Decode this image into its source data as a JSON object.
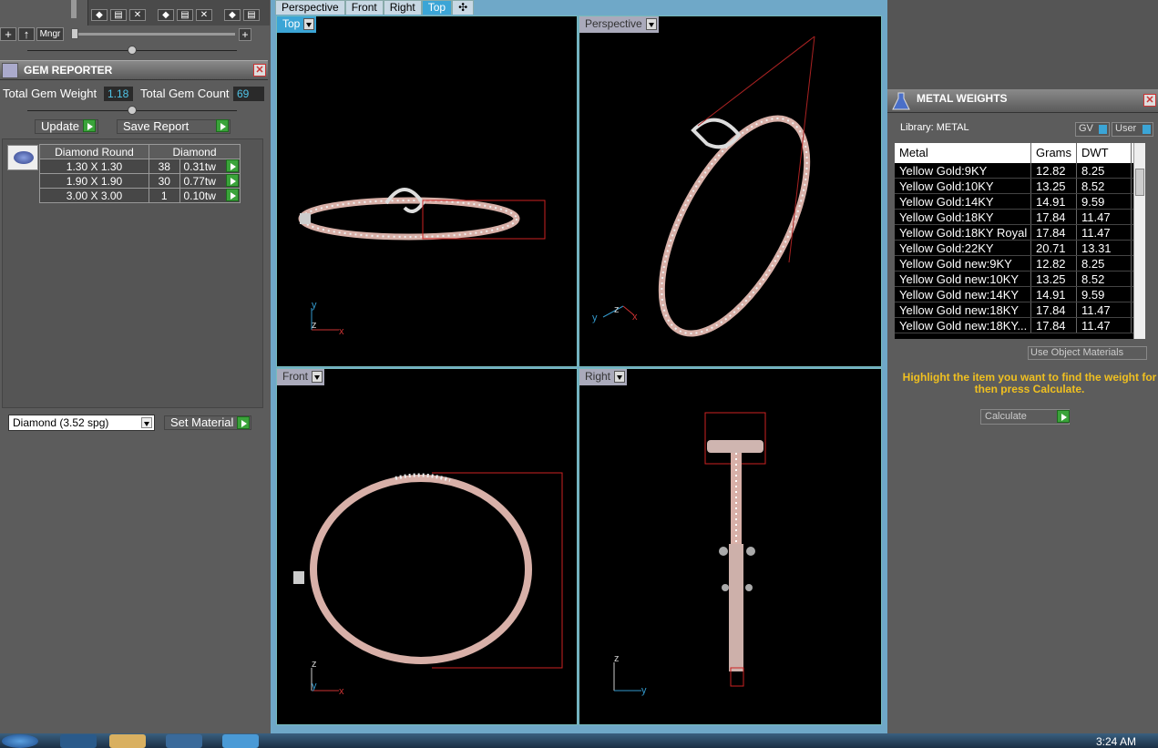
{
  "toolbar": {
    "add_label": "+",
    "up_label": "↑",
    "mngr_label": "Mngr",
    "plus_label": "+"
  },
  "gem_reporter": {
    "title": "GEM REPORTER",
    "total_weight_label": "Total Gem Weight",
    "total_weight_value": "1.18",
    "total_count_label": "Total Gem Count",
    "total_count_value": "69",
    "update_label": "Update",
    "save_report_label": "Save Report",
    "table": {
      "headers": [
        "Diamond Round",
        "Diamond"
      ],
      "rows": [
        {
          "size": "1.30 X 1.30",
          "count": "38",
          "tw": "0.31tw"
        },
        {
          "size": "1.90 X 1.90",
          "count": "30",
          "tw": "0.77tw"
        },
        {
          "size": "3.00 X 3.00",
          "count": "1",
          "tw": "0.10tw"
        }
      ]
    },
    "material_select": "Diamond    (3.52 spg)",
    "set_material_label": "Set Material"
  },
  "tabs": [
    {
      "label": "Perspective"
    },
    {
      "label": "Front"
    },
    {
      "label": "Right"
    },
    {
      "label": "Top"
    },
    {
      "label": "✣"
    }
  ],
  "viewports": {
    "top_left": "Top",
    "top_right": "Perspective",
    "bottom_left": "Front",
    "bottom_right": "Right"
  },
  "axes": {
    "y": "y",
    "z": "z",
    "x": "x"
  },
  "metal_weights": {
    "title": "METAL WEIGHTS",
    "library": "Library: METAL",
    "gv_label": "GV",
    "user_label": "User",
    "columns": [
      "Metal",
      "Grams",
      "DWT"
    ],
    "rows": [
      {
        "metal": "Yellow Gold:9KY",
        "grams": "12.82",
        "dwt": "8.25"
      },
      {
        "metal": "Yellow Gold:10KY",
        "grams": "13.25",
        "dwt": "8.52"
      },
      {
        "metal": "Yellow Gold:14KY",
        "grams": "14.91",
        "dwt": "9.59"
      },
      {
        "metal": "Yellow Gold:18KY",
        "grams": "17.84",
        "dwt": "11.47"
      },
      {
        "metal": "Yellow Gold:18KY Royal",
        "grams": "17.84",
        "dwt": "11.47"
      },
      {
        "metal": "Yellow Gold:22KY",
        "grams": "20.71",
        "dwt": "13.31"
      },
      {
        "metal": "Yellow Gold new:9KY",
        "grams": "12.82",
        "dwt": "8.25"
      },
      {
        "metal": "Yellow Gold new:10KY",
        "grams": "13.25",
        "dwt": "8.52"
      },
      {
        "metal": "Yellow Gold new:14KY",
        "grams": "14.91",
        "dwt": "9.59"
      },
      {
        "metal": "Yellow Gold new:18KY",
        "grams": "17.84",
        "dwt": "11.47"
      },
      {
        "metal": "Yellow Gold new:18KY...",
        "grams": "17.84",
        "dwt": "11.47"
      }
    ],
    "use_object_label": "Use Object Materials",
    "hint": "Highlight the item you want to find the weight for then press Calculate.",
    "calculate_label": "Calculate"
  },
  "taskbar": {
    "clock": "3:24 AM"
  }
}
